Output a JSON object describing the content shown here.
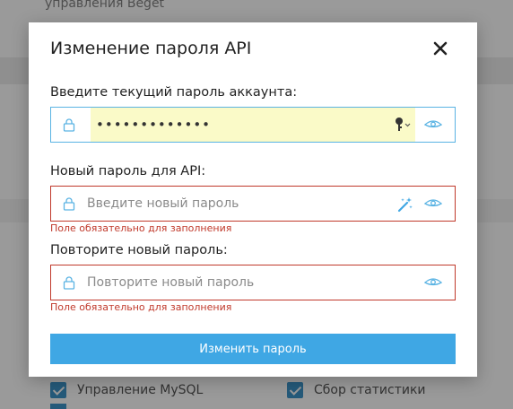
{
  "background": {
    "top_text": "управления Beget",
    "checkboxes": [
      {
        "label": "Управление MySQL",
        "checked": true
      },
      {
        "label": "Сбор статистики",
        "checked": true
      }
    ]
  },
  "modal": {
    "title": "Изменение пароля API",
    "close_icon": "close-icon",
    "current_password": {
      "label": "Введите текущий пароль аккаунта:",
      "value": "•••••••••••••"
    },
    "new_password": {
      "label": "Новый пароль для API:",
      "placeholder": "Введите новый пароль",
      "error": "Поле обязательно для заполнения"
    },
    "repeat_password": {
      "label": "Повторите новый пароль:",
      "placeholder": "Повторите новый пароль",
      "error": "Поле обязательно для заполнения"
    },
    "submit_label": "Изменить пароль"
  },
  "colors": {
    "accent": "#3fa7e4",
    "error": "#c0392b",
    "autofill": "#fafac8"
  }
}
